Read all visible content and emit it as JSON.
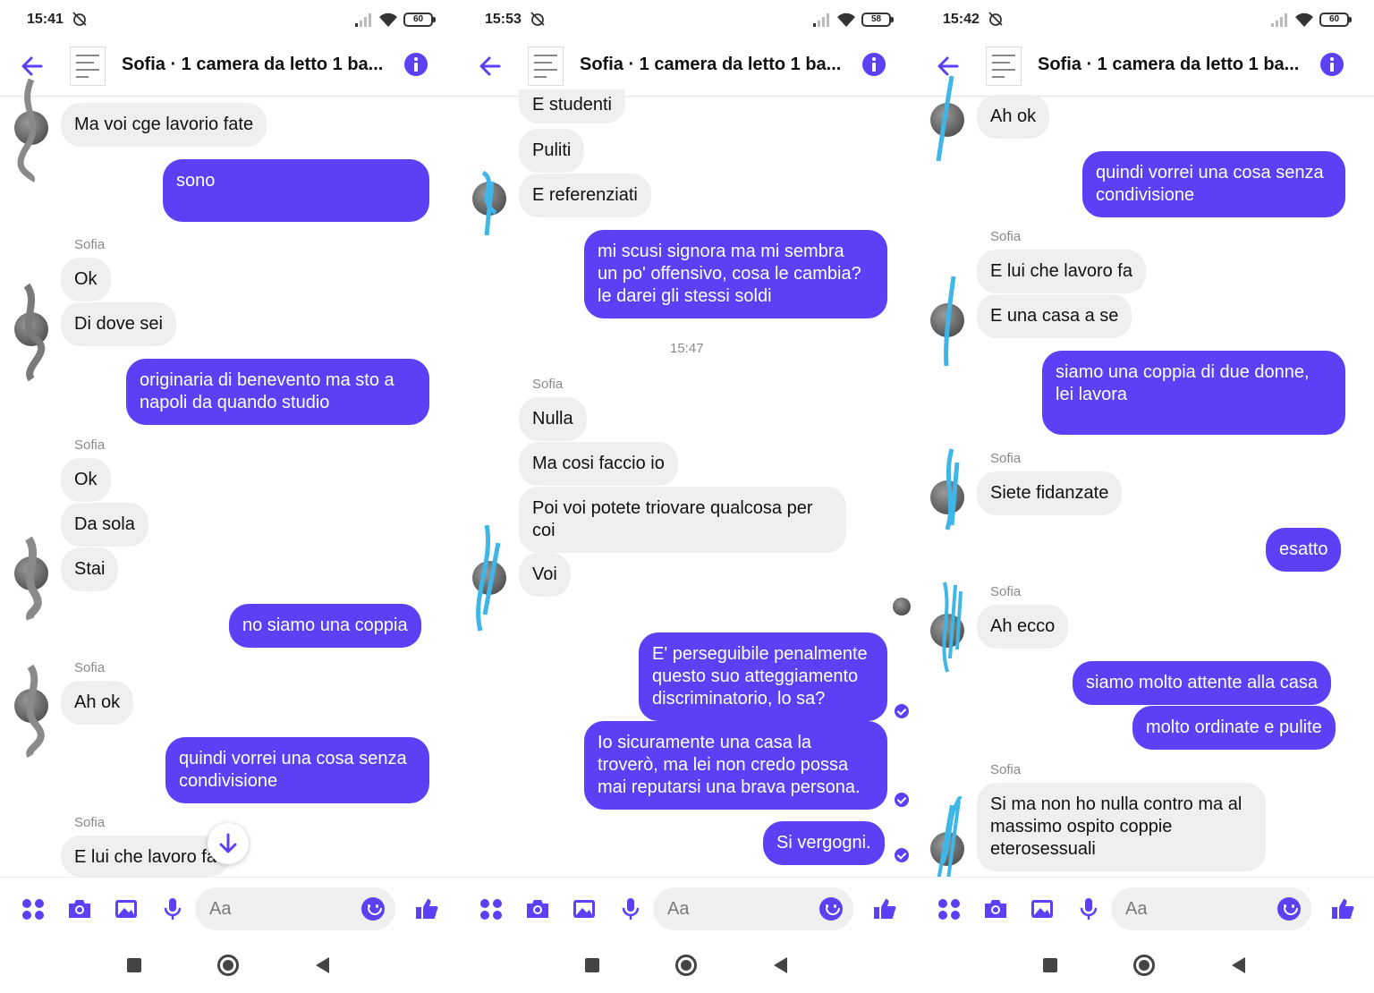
{
  "colors": {
    "accent": "#5b40f5",
    "incoming_bubble": "#efefef"
  },
  "common": {
    "title": "Sofia · 1 camera da letto 1 ba...",
    "composer_placeholder": "Aa"
  },
  "panels": [
    {
      "status": {
        "time": "15:41",
        "battery": "60"
      },
      "sender_labels": [
        "Sofia",
        "Sofia",
        "Sofia",
        "Sofia"
      ],
      "messages": [
        "Ma voi cge lavorio fate",
        "sono ,",
        "Ok",
        "Di dove sei",
        "originaria di benevento ma sto a\nnapoli da quando studio",
        "Ok",
        "Da sola",
        "Stai",
        "no siamo una coppia",
        "Ah ok",
        "quindi vorrei una cosa senza\ncondivisione",
        "E lui che lavoro fa"
      ]
    },
    {
      "status": {
        "time": "15:53",
        "battery": "58"
      },
      "sender_labels": [
        "Sofia"
      ],
      "timestamp": "15:47",
      "messages": [
        "E studenti",
        "Puliti",
        "E referenziati",
        "mi scusi signora ma mi sembra\nun po' offensivo, cosa le cambia?\nle darei gli stessi soldi",
        "Nulla",
        "Ma cosi faccio io",
        "Poi voi potete triovare qualcosa per\ncoi",
        "Voi",
        "E' perseguibile penalmente\nquesto suo atteggiamento\ndiscriminatorio, lo sa?",
        "Io sicuramente una casa la\ntroverò, ma lei non credo possa\nmai reputarsi una brava persona.",
        "Si vergogni."
      ]
    },
    {
      "status": {
        "time": "15:42",
        "battery": "60"
      },
      "sender_labels": [
        "Sofia",
        "Sofia",
        "Sofia",
        "Sofia"
      ],
      "messages": [
        "Ah ok",
        "quindi vorrei una cosa senza\ncondivisione",
        "E lui che lavoro fa",
        "E una casa a se",
        "siamo una coppia di due donne,\nlei lavora",
        "Siete fidanzate",
        "esatto",
        "Ah ecco",
        "siamo molto attente alla casa",
        "molto ordinate e pulite",
        "Si ma non ho nulla contro ma al\nmassimo ospito coppie\neterosessuali"
      ]
    }
  ]
}
